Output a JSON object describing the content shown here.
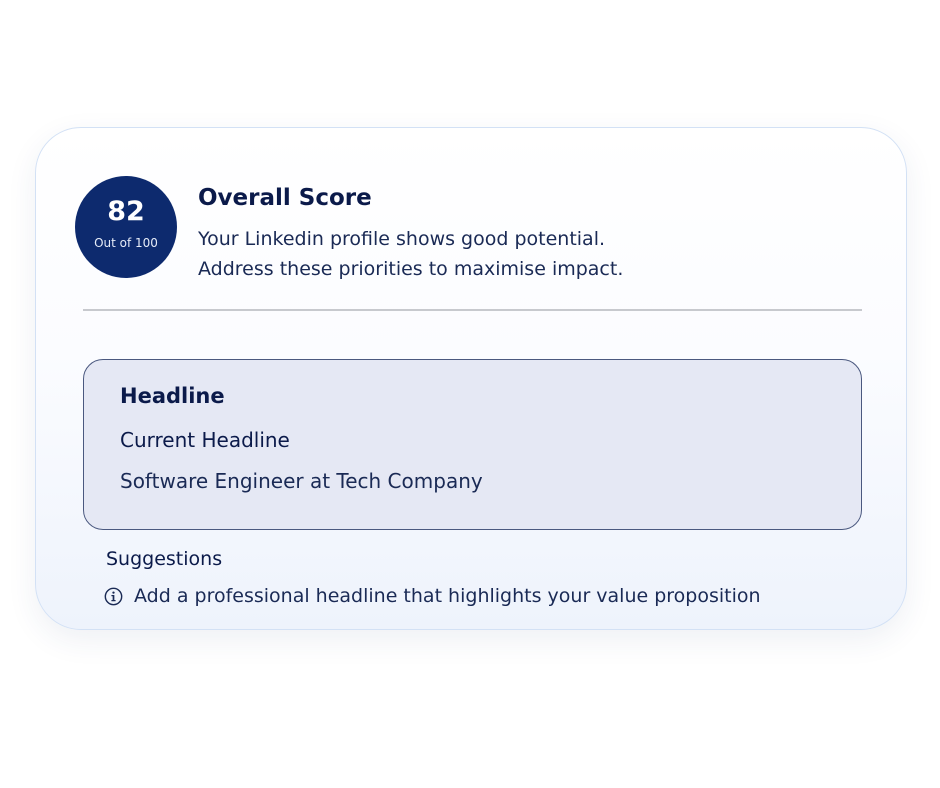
{
  "score": {
    "value": "82",
    "out_of": "Out of 100"
  },
  "overall": {
    "title": "Overall Score",
    "description_line1": "Your Linkedin profile shows good potential.",
    "description_line2": "Address these priorities to maximise impact."
  },
  "headline_section": {
    "title": "Headline",
    "current_label": "Current Headline",
    "current_value": "Software Engineer at Tech Company"
  },
  "suggestions": {
    "label": "Suggestions",
    "items": [
      {
        "icon": "info-icon",
        "text": "Add a professional headline that highlights your value proposition"
      }
    ]
  },
  "colors": {
    "score_circle": "#0d2a6e",
    "headline_box_bg": "#e5e8f4",
    "headline_box_border": "#4a587f",
    "text_primary": "#0b1a4a"
  }
}
